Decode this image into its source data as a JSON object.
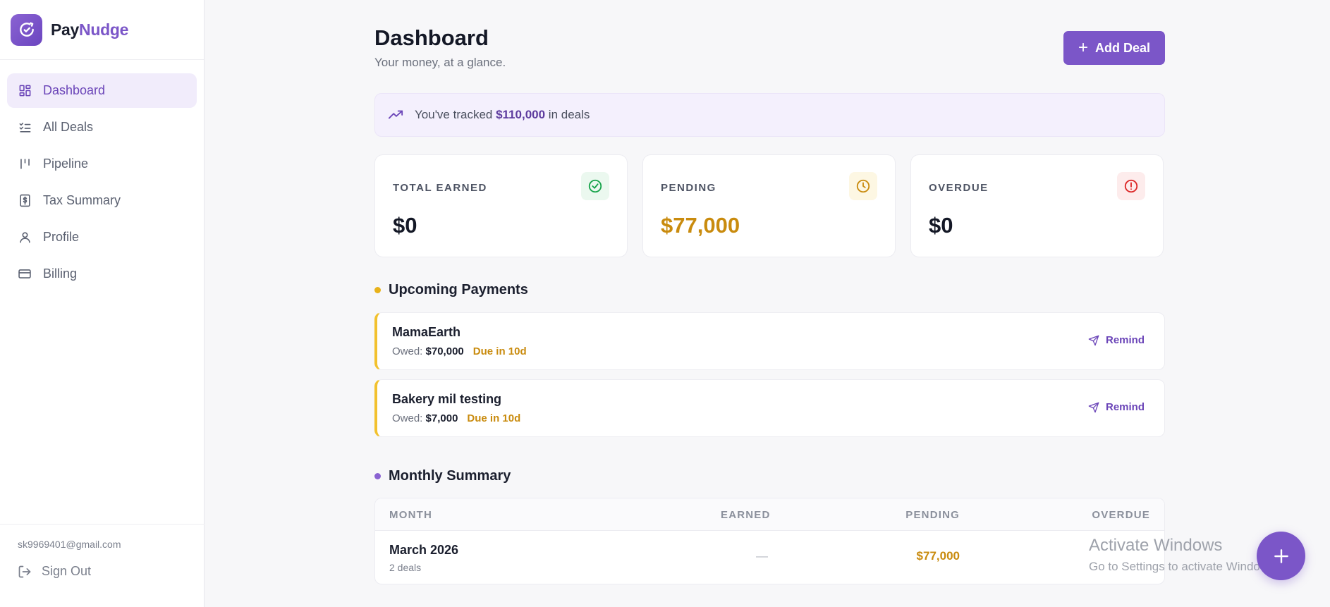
{
  "brand": {
    "name_part1": "Pay",
    "name_part2": "Nudge",
    "logo_icon": "paynudge-logo-icon"
  },
  "sidebar": {
    "items": [
      {
        "label": "Dashboard",
        "icon": "dashboard-icon",
        "active": true
      },
      {
        "label": "All Deals",
        "icon": "list-check-icon",
        "active": false
      },
      {
        "label": "Pipeline",
        "icon": "pipeline-icon",
        "active": false
      },
      {
        "label": "Tax Summary",
        "icon": "receipt-dollar-icon",
        "active": false
      },
      {
        "label": "Profile",
        "icon": "user-icon",
        "active": false
      },
      {
        "label": "Billing",
        "icon": "credit-card-icon",
        "active": false
      }
    ],
    "email": "sk9969401@gmail.com",
    "sign_out": "Sign Out"
  },
  "header": {
    "title": "Dashboard",
    "subtitle": "Your money, at a glance.",
    "add_deal": "Add Deal",
    "add_deal_icon": "plus-icon"
  },
  "tracked": {
    "prefix": "You've tracked ",
    "amount": "$110,000",
    "suffix": " in deals",
    "icon": "trending-up-icon"
  },
  "stats": [
    {
      "label": "TOTAL EARNED",
      "value": "$0",
      "icon": "check-circle-icon",
      "color": "#16a34a",
      "bg": "#ebf8ef"
    },
    {
      "label": "PENDING",
      "value": "$77,000",
      "icon": "clock-icon",
      "color": "#c98b0e",
      "bg": "#fdf7e3"
    },
    {
      "label": "OVERDUE",
      "value": "$0",
      "icon": "alert-circle-icon",
      "color": "#dc2626",
      "bg": "#fdecec"
    }
  ],
  "upcoming": {
    "title": "Upcoming Payments",
    "dot_color": "#e8b21a",
    "items": [
      {
        "name": "MamaEarth",
        "owed_label": "Owed: ",
        "owed": "$70,000",
        "due": "Due in 10d",
        "action": "Remind"
      },
      {
        "name": "Bakery mil testing",
        "owed_label": "Owed: ",
        "owed": "$7,000",
        "due": "Due in 10d",
        "action": "Remind"
      }
    ]
  },
  "monthly": {
    "title": "Monthly Summary",
    "dot_color": "#8a63d2",
    "columns": [
      "MONTH",
      "EARNED",
      "PENDING",
      "OVERDUE"
    ],
    "rows": [
      {
        "month": "March 2026",
        "deals": "2 deals",
        "earned": "—",
        "pending": "$77,000",
        "overdue": ""
      }
    ]
  },
  "watermark": {
    "line1": "Activate Windows",
    "line2": "Go to Settings to activate Windows."
  },
  "fab_icon": "plus-icon",
  "colors": {
    "accent": "#7b56c8",
    "accent_light": "#f1ecfb",
    "warning": "#c98b0e"
  }
}
